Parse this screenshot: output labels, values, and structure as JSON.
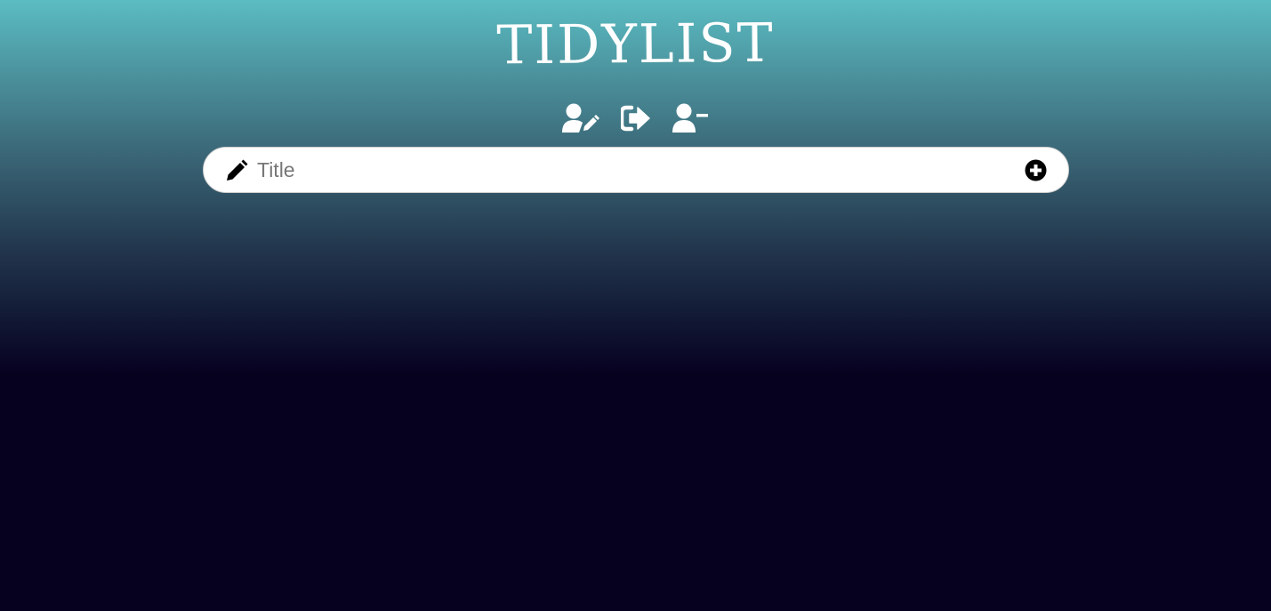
{
  "header": {
    "title": "TIDYLIST"
  },
  "toolbar": {
    "items": [
      {
        "icon": "user-edit-icon",
        "label": ""
      },
      {
        "icon": "sign-out-icon",
        "label": ""
      },
      {
        "icon": "user-minus-icon",
        "label": ""
      }
    ]
  },
  "add_form": {
    "icon": "pencil-icon",
    "input_value": "",
    "placeholder": "Title",
    "add_icon": "plus-circle-icon"
  },
  "colors": {
    "gradient_top": "#5bbcc2",
    "gradient_bottom": "#070120",
    "text": "#ffffff",
    "input_bg": "#ffffff",
    "placeholder": "#777777"
  }
}
